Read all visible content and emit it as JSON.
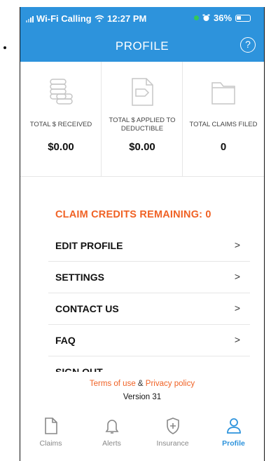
{
  "status_bar": {
    "carrier": "Wi-Fi Calling",
    "time": "12:27 PM",
    "battery": "36%",
    "icons": [
      "signal-icon",
      "wifi-icon",
      "alarm-icon",
      "battery-icon"
    ]
  },
  "header": {
    "title": "PROFILE",
    "help_label": "?"
  },
  "stats": [
    {
      "label": "TOTAL $ RECEIVED",
      "value": "$0.00",
      "icon": "coins-icon"
    },
    {
      "label": "TOTAL $ APPLIED TO DEDUCTIBLE",
      "value": "$0.00",
      "icon": "document-icon"
    },
    {
      "label": "TOTAL CLAIMS FILED",
      "value": "0",
      "icon": "folder-icon"
    }
  ],
  "credits": "CLAIM CREDITS REMAINING: 0",
  "menu": [
    {
      "label": "EDIT PROFILE",
      "chevron": ">"
    },
    {
      "label": "SETTINGS",
      "chevron": ">"
    },
    {
      "label": "CONTACT US",
      "chevron": ">"
    },
    {
      "label": "FAQ",
      "chevron": ">"
    },
    {
      "label": "SIGN OUT"
    }
  ],
  "footer": {
    "terms": "Terms of use",
    "amp": "&",
    "privacy": "Privacy policy",
    "version": "Version 31"
  },
  "tabs": [
    {
      "label": "Claims",
      "icon": "document-icon"
    },
    {
      "label": "Alerts",
      "icon": "bell-icon"
    },
    {
      "label": "Insurance",
      "icon": "shield-plus-icon"
    },
    {
      "label": "Profile",
      "icon": "user-icon",
      "active": true
    }
  ],
  "colors": {
    "brand": "#2d93dc",
    "accent": "#f06225"
  }
}
